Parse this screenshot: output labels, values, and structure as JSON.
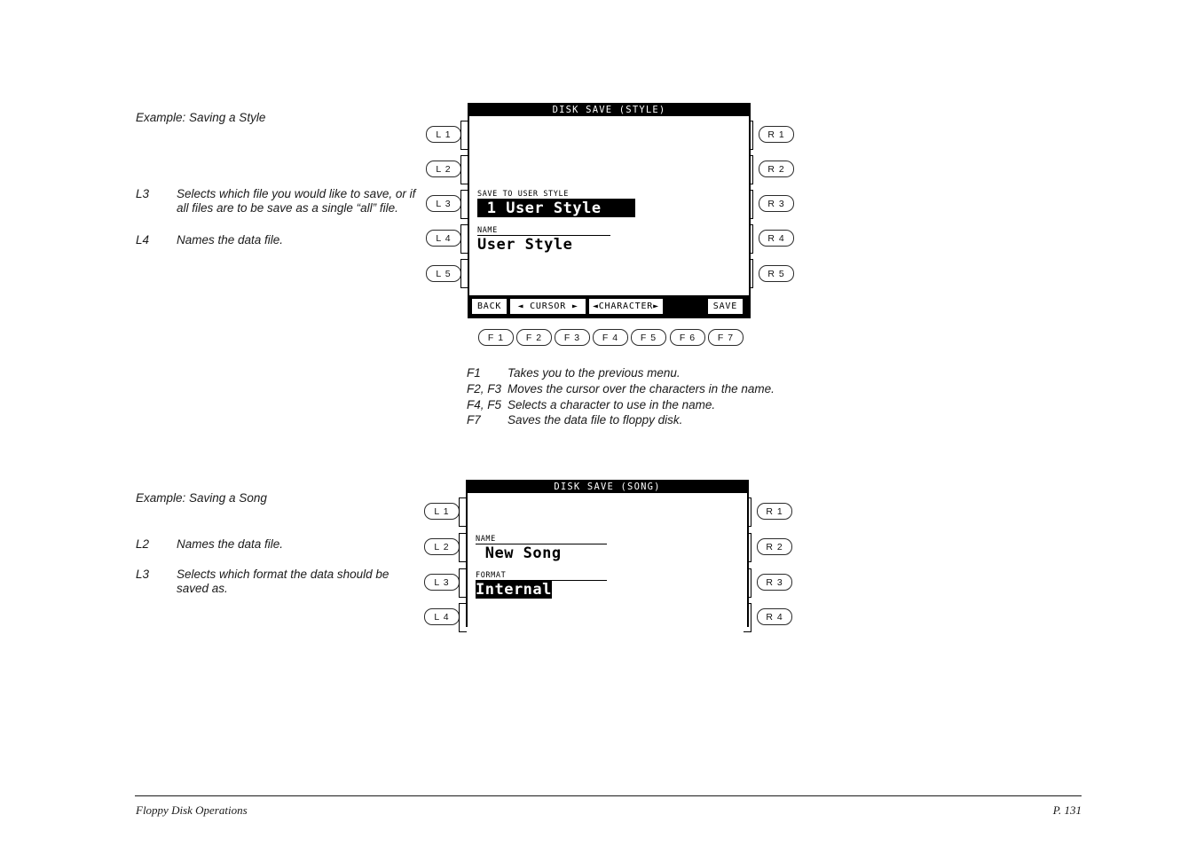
{
  "page": {
    "footer_left": "Floppy Disk Operations",
    "footer_right": "P. 131"
  },
  "section_style": {
    "heading": "Example: Saving a Style",
    "descriptions": [
      {
        "key": "L3",
        "text": "Selects which file you would like to save, or if all files are to be save as a single “all” file."
      },
      {
        "key": "L4",
        "text": "Names the data file."
      }
    ],
    "lcd": {
      "title": "DISK SAVE (STYLE)",
      "fields": [
        {
          "label": "SAVE TO USER STYLE",
          "value": " 1 User Style",
          "inverted": true
        },
        {
          "label": "NAME",
          "value": "User Style",
          "inverted": false
        }
      ],
      "softkeys": [
        {
          "label": "BACK",
          "kind": "key"
        },
        {
          "label": "◄ CURSOR ►",
          "kind": "key"
        },
        {
          "label": "◄CHARACTER►",
          "kind": "key"
        },
        {
          "label": "",
          "kind": "spacer"
        },
        {
          "label": "SAVE",
          "kind": "key"
        }
      ]
    },
    "left_buttons": [
      "L 1",
      "L 2",
      "L 3",
      "L 4",
      "L 5"
    ],
    "right_buttons": [
      "R 1",
      "R 2",
      "R 3",
      "R 4",
      "R 5"
    ],
    "function_buttons": [
      "F 1",
      "F 2",
      "F 3",
      "F 4",
      "F 5",
      "F 6",
      "F 7"
    ],
    "function_notes": [
      {
        "key": "F1",
        "text": "Takes you to the previous menu."
      },
      {
        "key": "F2, F3",
        "text": "Moves the cursor over the characters in the name."
      },
      {
        "key": "F4, F5",
        "text": "Selects a character to use in the name."
      },
      {
        "key": "F7",
        "text": "Saves the data file to floppy disk."
      }
    ]
  },
  "section_song": {
    "heading": "Example: Saving a Song",
    "descriptions": [
      {
        "key": "L2",
        "text": "Names the data file."
      },
      {
        "key": "L3",
        "text": "Selects which format the data should be saved as."
      }
    ],
    "lcd": {
      "title": "DISK SAVE (SONG)",
      "fields": [
        {
          "label": "NAME",
          "value": " New Song",
          "inverted": false
        },
        {
          "label": "FORMAT",
          "value": "Internal",
          "inverted": true
        }
      ]
    },
    "left_buttons": [
      "L 1",
      "L 2",
      "L 3",
      "L 4"
    ],
    "right_buttons": [
      "R 1",
      "R 2",
      "R 3",
      "R 4"
    ]
  }
}
